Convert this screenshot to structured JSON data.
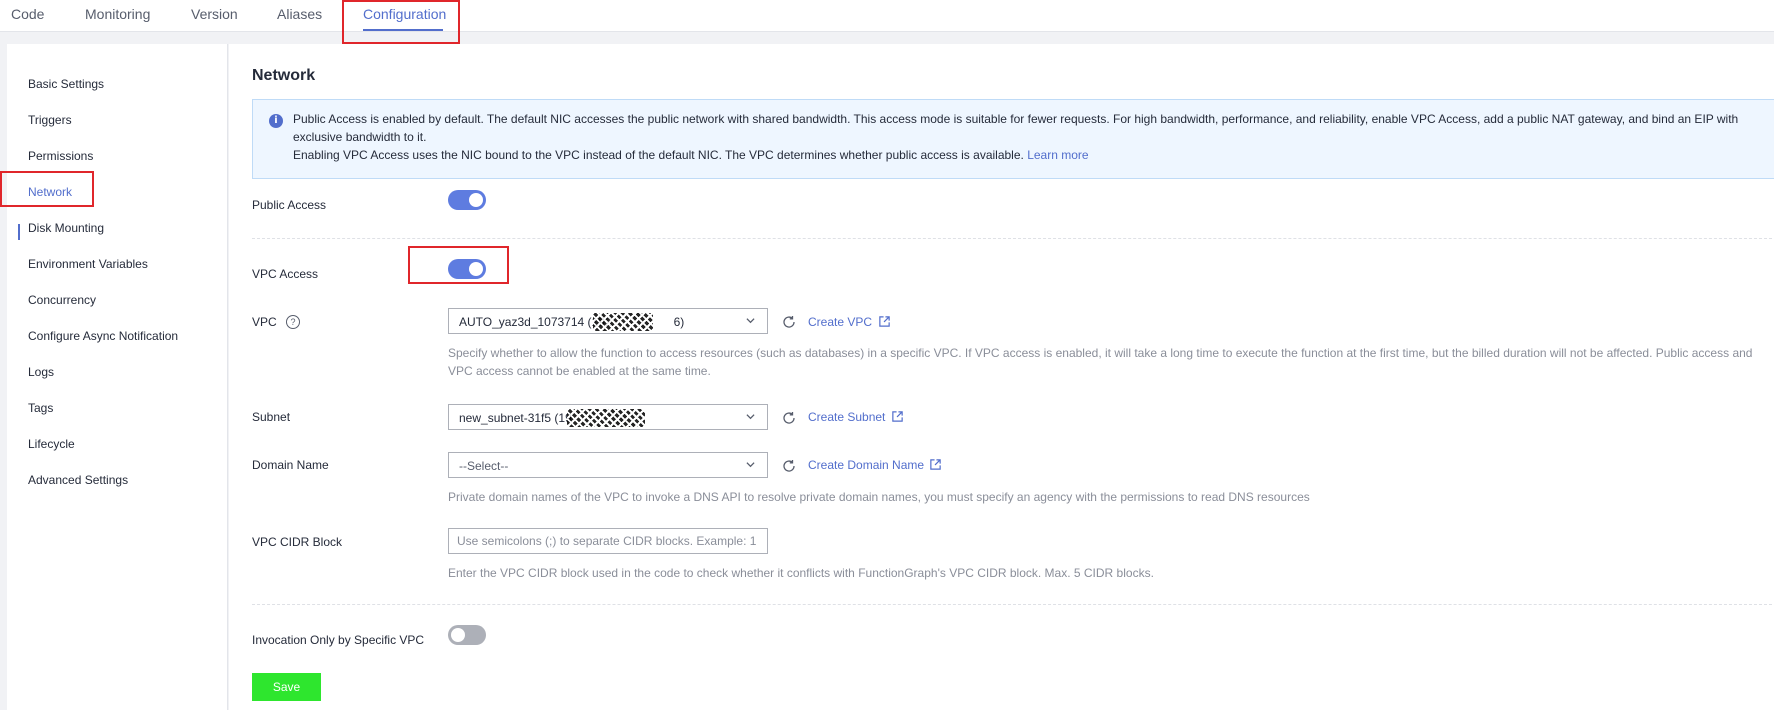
{
  "tabs": [
    {
      "label": "Code"
    },
    {
      "label": "Monitoring"
    },
    {
      "label": "Version"
    },
    {
      "label": "Aliases"
    },
    {
      "label": "Configuration",
      "active": true
    }
  ],
  "sidebar": {
    "items": [
      {
        "label": "Basic Settings"
      },
      {
        "label": "Triggers"
      },
      {
        "label": "Permissions"
      },
      {
        "label": "Network",
        "active": true
      },
      {
        "label": "Disk Mounting"
      },
      {
        "label": "Environment Variables"
      },
      {
        "label": "Concurrency"
      },
      {
        "label": "Configure Async Notification"
      },
      {
        "label": "Logs"
      },
      {
        "label": "Tags"
      },
      {
        "label": "Lifecycle"
      },
      {
        "label": "Advanced Settings"
      }
    ]
  },
  "network": {
    "title": "Network",
    "info": {
      "line1": "Public Access is enabled by default. The default NIC accesses the public network with shared bandwidth. This access mode is suitable for fewer requests. For high bandwidth, performance, and reliability, enable VPC Access, add a public NAT gateway, and bind an EIP with exclusive bandwidth to it.",
      "line2": "Enabling VPC Access uses the NIC bound to the VPC instead of the default NIC. The VPC determines whether public access is available.",
      "learn_more": "Learn more"
    },
    "public_access": {
      "label": "Public Access",
      "enabled": true
    },
    "vpc_access": {
      "label": "VPC Access",
      "enabled": true
    },
    "vpc": {
      "label": "VPC",
      "value_prefix": "AUTO_yaz3d_1073714 (192",
      "value_suffix": "6)",
      "create_label": "Create VPC",
      "hint": "Specify whether to allow the function to access resources (such as databases) in a specific VPC. If VPC access is enabled, it will take a long time to execute the function at the first time, but the billed duration will not be affected. Public access and VPC access cannot be enabled at the same time."
    },
    "subnet": {
      "label": "Subnet",
      "value_prefix": "new_subnet-31f5 (19",
      "create_label": "Create Subnet"
    },
    "domain": {
      "label": "Domain Name",
      "placeholder": "--Select--",
      "create_label": "Create Domain Name",
      "hint": "Private domain names of the VPC to invoke a DNS API to resolve private domain names, you must specify an agency with the permissions to read DNS resources"
    },
    "cidr": {
      "label": "VPC CIDR Block",
      "placeholder": "Use semicolons (;) to separate CIDR blocks. Example: 1",
      "hint": "Enter the VPC CIDR block used in the code to check whether it conflicts with FunctionGraph's VPC CIDR block. Max. 5 CIDR blocks."
    },
    "invocation_only": {
      "label": "Invocation Only by Specific VPC",
      "enabled": false
    },
    "save_label": "Save"
  },
  "colors": {
    "accent": "#526ecc",
    "toggle_on": "#5e7ce0",
    "toggle_off": "#adb0b8",
    "save_button": "#2ee62e",
    "highlight_box": "#e0262b",
    "info_bg": "#eef6ff"
  },
  "icons": {
    "info": "info-icon",
    "help": "help-circle-icon",
    "chevron": "chevron-down-icon",
    "refresh": "refresh-icon",
    "external": "external-link-icon"
  }
}
